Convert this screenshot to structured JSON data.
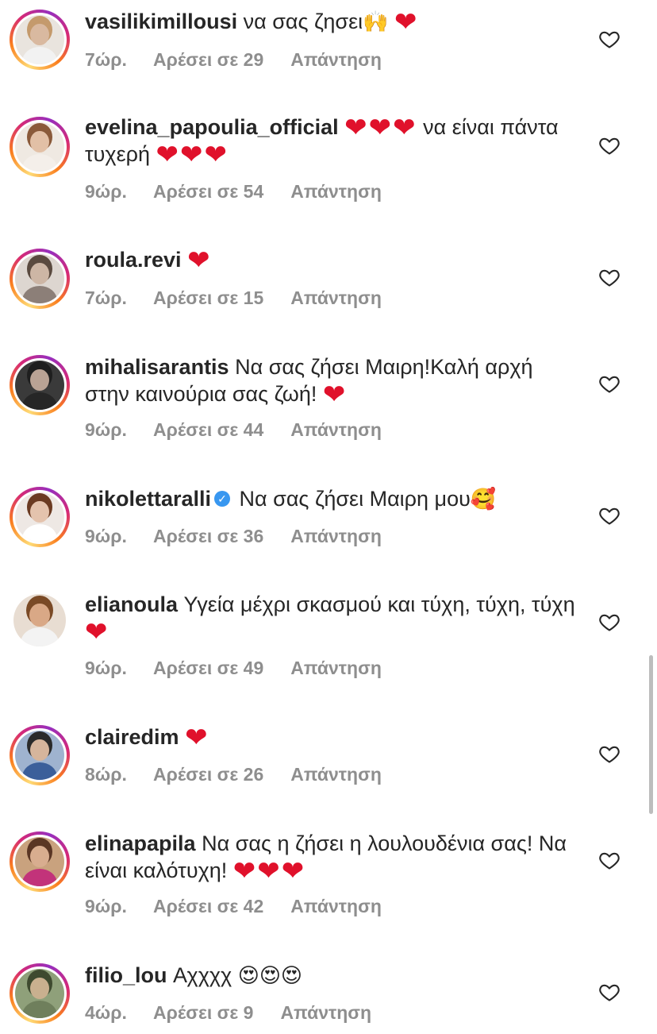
{
  "comments": [
    {
      "username": "vasilikimillousi",
      "verified": false,
      "text": " να σας ζησει",
      "emojis": "🙌",
      "hearts": "❤",
      "time": "7ώρ.",
      "likes": "Αρέσει σε 29",
      "reply": "Απάντηση",
      "ring": true,
      "skin": "#d9b9a0",
      "hair": "#c49a6c",
      "shirt": "#f2f2f2"
    },
    {
      "username": "evelina_papoulia_official",
      "verified": false,
      "text": "",
      "hearts": "❤❤❤",
      "text2": " να είναι πάντα τυχερή ",
      "hearts2": "❤❤❤",
      "time": "9ώρ.",
      "likes": "Αρέσει σε 54",
      "reply": "Απάντηση",
      "ring": true,
      "skin": "#e2c0a6",
      "hair": "#8a5a3a",
      "shirt": "#f4efea"
    },
    {
      "username": "roula.revi",
      "verified": false,
      "text": " ",
      "hearts": "❤",
      "time": "7ώρ.",
      "likes": "Αρέσει σε 15",
      "reply": "Απάντηση",
      "ring": true,
      "skin": "#cdb6a5",
      "hair": "#5a4a3f",
      "shirt": "#8c7f78"
    },
    {
      "username": "mihalisarantis",
      "verified": false,
      "text": " Να σας ζήσει Μαιρη!Καλή αρχή στην καινούρια σας ζωή! ",
      "hearts": "❤",
      "time": "9ώρ.",
      "likes": "Αρέσει σε 44",
      "reply": "Απάντηση",
      "ring": true,
      "skin": "#b9a294",
      "hair": "#1e1e1e",
      "shirt": "#262626"
    },
    {
      "username": "nikolettaralli",
      "verified": true,
      "text": " Να σας ζήσει Μαιρη μου",
      "emojis": "🥰",
      "time": "9ώρ.",
      "likes": "Αρέσει σε 36",
      "reply": "Απάντηση",
      "ring": true,
      "skin": "#e4c3ad",
      "hair": "#6b3b22",
      "shirt": "#ffffff"
    },
    {
      "username": "elianoula",
      "verified": false,
      "text": " Υγεία μέχρι σκασμού και τύχη, τύχη, τύχη ",
      "hearts": "❤",
      "time": "9ώρ.",
      "likes": "Αρέσει σε 49",
      "reply": "Απάντηση",
      "ring": false,
      "skin": "#d9a886",
      "hair": "#7a4a26",
      "shirt": "#f3f3f3"
    },
    {
      "username": "clairedim",
      "verified": false,
      "text": " ",
      "hearts": "❤",
      "time": "8ώρ.",
      "likes": "Αρέσει σε 26",
      "reply": "Απάντηση",
      "ring": true,
      "skin": "#d6b59c",
      "hair": "#2a2a2a",
      "shirt": "#3b5f9a"
    },
    {
      "username": "elinapapila",
      "verified": false,
      "text": " Να σας η ζήσει η λουλουδένια σας! Να είναι καλότυχη! ",
      "hearts": "❤❤❤",
      "time": "9ώρ.",
      "likes": "Αρέσει σε 42",
      "reply": "Απάντηση",
      "ring": true,
      "skin": "#d8ad8f",
      "hair": "#5a3624",
      "shirt": "#c2337a"
    },
    {
      "username": "filio_lou",
      "verified": false,
      "text": " Αχχχχ ",
      "emojis": "😍😍😍",
      "time": "4ώρ.",
      "likes": "Αρέσει σε 9",
      "reply": "Απάντηση",
      "ring": true,
      "skin": "#c9b08f",
      "hair": "#3e4a2f",
      "shirt": "#6f7f5c"
    }
  ],
  "colors": {
    "heart": "#e0112b",
    "meta": "#8e8e8e",
    "text": "#262626",
    "verified": "#3897f0"
  },
  "icons": {
    "like": "heart-outline-icon",
    "verified": "verified-badge-icon"
  }
}
